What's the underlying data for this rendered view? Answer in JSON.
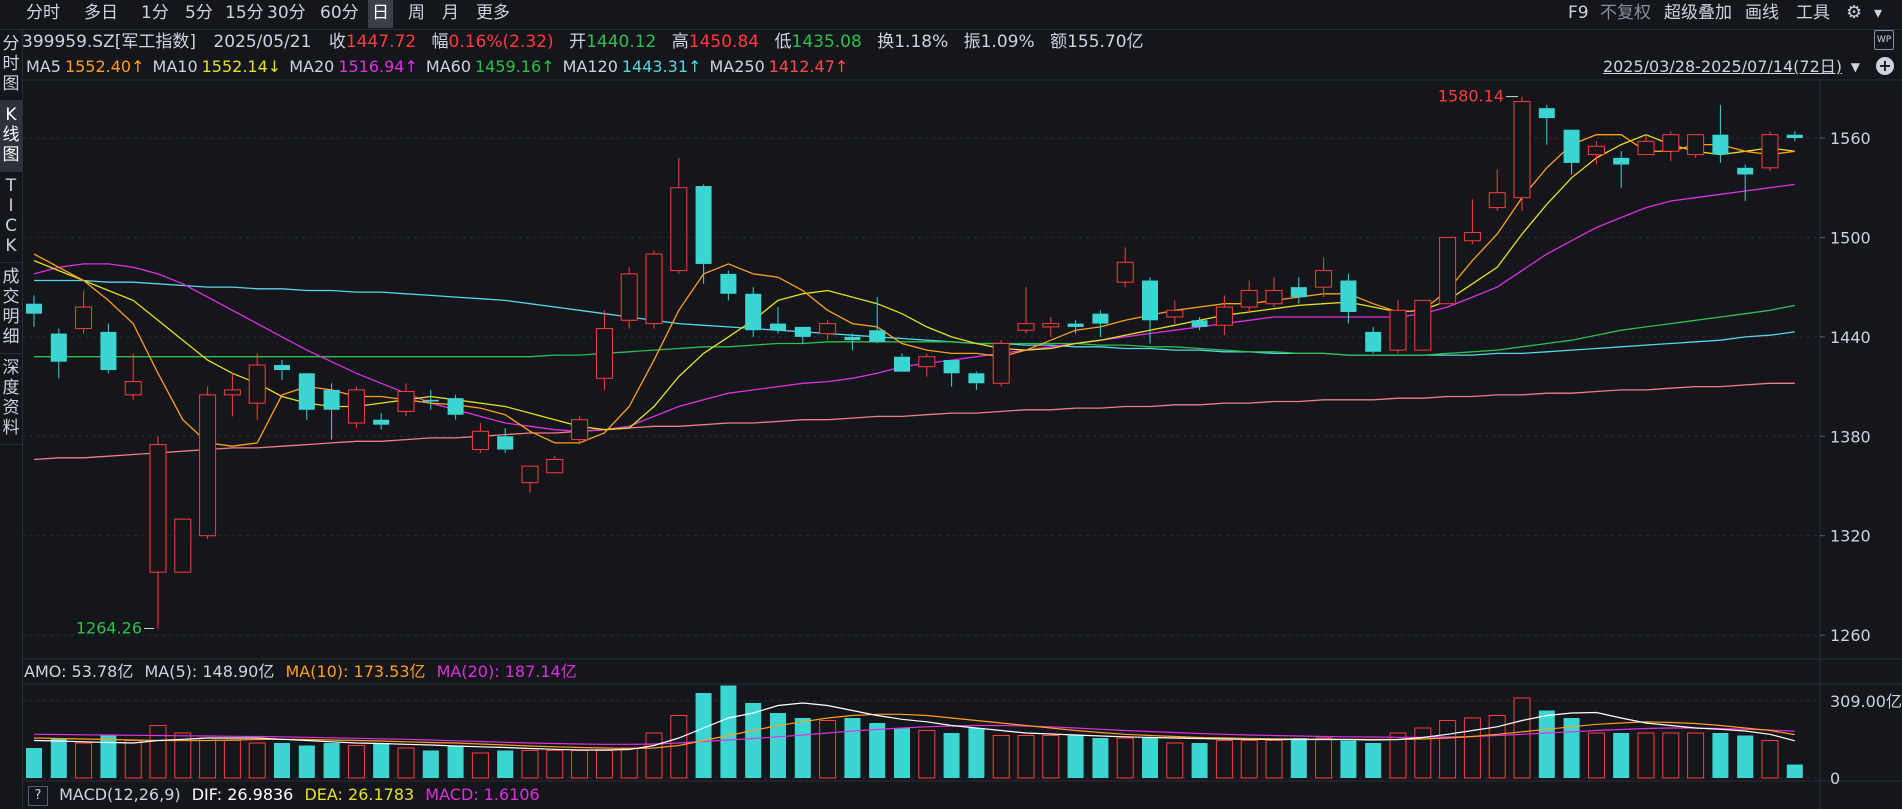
{
  "colors": {
    "up": "#ff3b3b",
    "down": "#3cd6d2",
    "ma5": "#ff9f1c",
    "ma10": "#e5e025",
    "ma20": "#e030e0",
    "ma60": "#2ec04a",
    "ma120": "#56d6e8",
    "ma250": "#f08080",
    "vol_ma5": "#ffffff",
    "vol_ma10": "#ff9f1c",
    "vol_ma20": "#e030e0"
  },
  "tabs": [
    {
      "label": "分时"
    },
    {
      "label": "多日"
    },
    {
      "label": "1分"
    },
    {
      "label": "5分"
    },
    {
      "label": "15分"
    },
    {
      "label": "30分"
    },
    {
      "label": "60分"
    },
    {
      "label": "日"
    },
    {
      "label": "周"
    },
    {
      "label": "月"
    },
    {
      "label": "更多"
    }
  ],
  "active_tab": "日",
  "right_tools": {
    "f9": "F9",
    "adjust": "不复权",
    "overlay": "超级叠加",
    "draw": "画线",
    "tools": "工具"
  },
  "sidebar": [
    {
      "label": "分时图",
      "id": "fenshi"
    },
    {
      "label": "K线图",
      "id": "kline"
    },
    {
      "label": "TICK",
      "id": "tick"
    },
    {
      "label": "成交明细",
      "id": "trade"
    },
    {
      "label": "深度资料",
      "id": "f10"
    }
  ],
  "info": {
    "code": "399959.SZ",
    "name": "[军工指数]",
    "date": "2025/05/21",
    "close_label": "收",
    "close": "1447.72",
    "change_label": "幅",
    "change": "0.16%(2.32)",
    "open_label": "开",
    "open": "1440.12",
    "high_label": "高",
    "high": "1450.84",
    "low_label": "低",
    "low": "1435.08",
    "turnover_label": "换",
    "turnover": "1.18%",
    "amplitude_label": "振",
    "amplitude": "1.09%",
    "amount_label": "额",
    "amount": "155.70亿"
  },
  "ma_legend": [
    {
      "label": "MA5",
      "value": "1552.40↑",
      "color": "#ff9f1c"
    },
    {
      "label": "MA10",
      "value": "1552.14↓",
      "color": "#e5e025"
    },
    {
      "label": "MA20",
      "value": "1516.94↑",
      "color": "#e030e0"
    },
    {
      "label": "MA60",
      "value": "1459.16↑",
      "color": "#2ec04a"
    },
    {
      "label": "MA120",
      "value": "1443.31↑",
      "color": "#56d6e8"
    },
    {
      "label": "MA250",
      "value": "1412.47↑",
      "color": "#ff4b4b"
    }
  ],
  "date_range": "2025/03/28-2025/07/14(72日)",
  "amo": {
    "label": "AMO:",
    "value": "53.78亿",
    "ma5_label": "MA(5):",
    "ma5": "148.90亿",
    "ma10_label": "MA(10):",
    "ma10": "173.53亿",
    "ma20_label": "MA(20):",
    "ma20": "187.14亿"
  },
  "macd": {
    "help": "?",
    "label": "MACD(12,26,9)",
    "dif_label": "DIF:",
    "dif": "26.9836",
    "dea_label": "DEA:",
    "dea": "26.1783",
    "macd_label": "MACD:",
    "macd": "1.6106"
  },
  "chart_data": {
    "type": "candlestick",
    "ylim": [
      1245,
      1595
    ],
    "yticks": [
      "1560",
      "1500",
      "1440",
      "1380",
      "1320",
      "1260"
    ],
    "max_label": "1580.14",
    "min_label": "1264.26",
    "candles": [
      [
        1460,
        1454,
        1465,
        1446
      ],
      [
        1442,
        1425,
        1445,
        1415
      ],
      [
        1445,
        1458,
        1468,
        1442
      ],
      [
        1443,
        1420,
        1448,
        1418
      ],
      [
        1405,
        1413,
        1430,
        1402
      ],
      [
        1298,
        1375,
        1380,
        1264
      ],
      [
        1298,
        1330,
        1330,
        1298
      ],
      [
        1320,
        1405,
        1410,
        1318
      ],
      [
        1405,
        1408,
        1418,
        1392
      ],
      [
        1400,
        1423,
        1430,
        1390
      ],
      [
        1423,
        1420,
        1426,
        1414
      ],
      [
        1418,
        1396,
        1418,
        1390
      ],
      [
        1408,
        1396,
        1412,
        1378
      ],
      [
        1388,
        1408,
        1410,
        1385
      ],
      [
        1390,
        1387,
        1394,
        1384
      ],
      [
        1395,
        1407,
        1412,
        1392
      ],
      [
        1402,
        1401,
        1408,
        1396
      ],
      [
        1403,
        1393,
        1405,
        1390
      ],
      [
        1372,
        1383,
        1388,
        1370
      ],
      [
        1380,
        1372,
        1385,
        1370
      ],
      [
        1352,
        1362,
        1362,
        1346
      ],
      [
        1358,
        1366,
        1368,
        1358
      ],
      [
        1378,
        1390,
        1392,
        1375
      ],
      [
        1415,
        1445,
        1456,
        1408
      ],
      [
        1450,
        1478,
        1482,
        1445
      ],
      [
        1448,
        1490,
        1492,
        1445
      ],
      [
        1480,
        1530,
        1548,
        1478
      ],
      [
        1531,
        1484,
        1532,
        1472
      ],
      [
        1478,
        1466,
        1480,
        1462
      ],
      [
        1466,
        1444,
        1470,
        1440
      ],
      [
        1448,
        1444,
        1458,
        1442
      ],
      [
        1446,
        1440,
        1446,
        1436
      ],
      [
        1442,
        1448,
        1450,
        1438
      ],
      [
        1440,
        1438,
        1442,
        1432
      ],
      [
        1444,
        1437,
        1464,
        1436
      ],
      [
        1428,
        1419,
        1430,
        1419
      ],
      [
        1422,
        1428,
        1430,
        1416
      ],
      [
        1426,
        1418,
        1426,
        1410
      ],
      [
        1418,
        1412,
        1419,
        1408
      ],
      [
        1412,
        1436,
        1438,
        1410
      ],
      [
        1444,
        1448,
        1470,
        1442
      ],
      [
        1446,
        1448,
        1452,
        1440
      ],
      [
        1448,
        1446,
        1450,
        1442
      ],
      [
        1454,
        1448,
        1456,
        1440
      ],
      [
        1473,
        1485,
        1494,
        1470
      ],
      [
        1474,
        1450,
        1476,
        1436
      ],
      [
        1452,
        1456,
        1462,
        1448
      ],
      [
        1450,
        1446,
        1452,
        1444
      ],
      [
        1447,
        1458,
        1465,
        1441
      ],
      [
        1458,
        1468,
        1474,
        1455
      ],
      [
        1460,
        1468,
        1476,
        1458
      ],
      [
        1470,
        1464,
        1476,
        1460
      ],
      [
        1470,
        1480,
        1488,
        1464
      ],
      [
        1474,
        1455,
        1478,
        1448
      ],
      [
        1443,
        1431,
        1446,
        1430
      ],
      [
        1432,
        1456,
        1462,
        1430
      ],
      [
        1432,
        1462,
        1462,
        1432
      ],
      [
        1460,
        1500,
        1500,
        1460
      ],
      [
        1498,
        1503,
        1523,
        1496
      ],
      [
        1518,
        1527,
        1541,
        1516
      ],
      [
        1524,
        1582,
        1585,
        1516
      ],
      [
        1578,
        1572,
        1580,
        1556
      ],
      [
        1565,
        1545,
        1565,
        1538
      ],
      [
        1550,
        1555,
        1558,
        1544
      ],
      [
        1548,
        1544,
        1552,
        1530
      ],
      [
        1550,
        1558,
        1562,
        1550
      ],
      [
        1552,
        1562,
        1564,
        1546
      ],
      [
        1550,
        1562,
        1562,
        1548
      ],
      [
        1562,
        1550,
        1580,
        1545
      ],
      [
        1542,
        1538,
        1544,
        1522
      ],
      [
        1542,
        1562,
        1564,
        1540
      ],
      [
        1562,
        1560,
        1564,
        1558
      ]
    ],
    "ma5": [
      1490,
      1482,
      1474,
      1462,
      1448,
      1418,
      1390,
      1376,
      1374,
      1376,
      1405,
      1410,
      1408,
      1404,
      1404,
      1402,
      1400,
      1399,
      1397,
      1393,
      1383,
      1376,
      1376,
      1382,
      1398,
      1426,
      1456,
      1478,
      1484,
      1478,
      1476,
      1468,
      1456,
      1448,
      1446,
      1436,
      1432,
      1430,
      1430,
      1428,
      1432,
      1438,
      1444,
      1446,
      1450,
      1453,
      1456,
      1458,
      1460,
      1460,
      1462,
      1464,
      1466,
      1466,
      1460,
      1455,
      1456,
      1468,
      1486,
      1502,
      1524,
      1542,
      1556,
      1562,
      1562,
      1552,
      1552,
      1556,
      1556,
      1552,
      1550,
      1552
    ],
    "ma10": [
      1486,
      1480,
      1474,
      1468,
      1462,
      1450,
      1438,
      1426,
      1418,
      1412,
      1404,
      1400,
      1398,
      1398,
      1400,
      1402,
      1404,
      1402,
      1400,
      1398,
      1394,
      1390,
      1386,
      1384,
      1385,
      1398,
      1416,
      1430,
      1440,
      1450,
      1462,
      1466,
      1468,
      1464,
      1460,
      1454,
      1446,
      1440,
      1436,
      1433,
      1432,
      1433,
      1436,
      1438,
      1441,
      1444,
      1447,
      1450,
      1453,
      1455,
      1457,
      1459,
      1460,
      1461,
      1458,
      1455,
      1456,
      1462,
      1472,
      1482,
      1502,
      1520,
      1536,
      1548,
      1556,
      1562,
      1556,
      1552,
      1550,
      1552,
      1554,
      1552
    ],
    "ma20": [
      1478,
      1482,
      1484,
      1484,
      1482,
      1478,
      1472,
      1464,
      1456,
      1448,
      1440,
      1432,
      1425,
      1418,
      1412,
      1406,
      1400,
      1396,
      1392,
      1388,
      1386,
      1384,
      1383,
      1384,
      1386,
      1392,
      1398,
      1402,
      1406,
      1408,
      1410,
      1412,
      1413,
      1415,
      1418,
      1422,
      1424,
      1426,
      1428,
      1430,
      1432,
      1434,
      1436,
      1438,
      1440,
      1442,
      1444,
      1446,
      1448,
      1450,
      1452,
      1452,
      1452,
      1452,
      1452,
      1452,
      1454,
      1458,
      1464,
      1470,
      1480,
      1490,
      1498,
      1506,
      1512,
      1518,
      1522,
      1524,
      1526,
      1528,
      1530,
      1532
    ],
    "ma60": [
      1428,
      1428,
      1428,
      1428,
      1428,
      1428,
      1428,
      1428,
      1428,
      1428,
      1428,
      1428,
      1428,
      1428,
      1428,
      1428,
      1428,
      1428,
      1428,
      1428,
      1428,
      1429,
      1429,
      1430,
      1431,
      1432,
      1433,
      1434,
      1434,
      1435,
      1436,
      1436,
      1437,
      1437,
      1437,
      1437,
      1437,
      1437,
      1436,
      1436,
      1436,
      1436,
      1436,
      1435,
      1435,
      1434,
      1434,
      1433,
      1432,
      1431,
      1431,
      1430,
      1430,
      1429,
      1429,
      1429,
      1429,
      1430,
      1431,
      1432,
      1434,
      1436,
      1438,
      1441,
      1444,
      1446,
      1448,
      1450,
      1452,
      1454,
      1456,
      1459
    ],
    "ma120": [
      1474,
      1474,
      1474,
      1473,
      1473,
      1472,
      1471,
      1470,
      1470,
      1469,
      1469,
      1468,
      1468,
      1467,
      1467,
      1466,
      1465,
      1464,
      1463,
      1462,
      1460,
      1458,
      1456,
      1454,
      1452,
      1450,
      1448,
      1447,
      1446,
      1445,
      1444,
      1443,
      1442,
      1441,
      1440,
      1439,
      1438,
      1437,
      1436,
      1436,
      1435,
      1435,
      1434,
      1434,
      1433,
      1433,
      1432,
      1432,
      1431,
      1431,
      1430,
      1430,
      1430,
      1429,
      1429,
      1429,
      1429,
      1429,
      1429,
      1430,
      1430,
      1431,
      1432,
      1433,
      1434,
      1435,
      1436,
      1437,
      1438,
      1440,
      1441,
      1443
    ],
    "ma250": [
      1366,
      1367,
      1367,
      1368,
      1369,
      1370,
      1371,
      1372,
      1373,
      1373,
      1374,
      1375,
      1376,
      1377,
      1377,
      1378,
      1379,
      1379,
      1380,
      1381,
      1382,
      1382,
      1383,
      1384,
      1385,
      1386,
      1386,
      1387,
      1388,
      1388,
      1389,
      1390,
      1390,
      1391,
      1392,
      1392,
      1393,
      1394,
      1394,
      1395,
      1396,
      1396,
      1397,
      1397,
      1398,
      1398,
      1399,
      1399,
      1400,
      1400,
      1401,
      1401,
      1402,
      1402,
      1402,
      1403,
      1403,
      1404,
      1404,
      1405,
      1405,
      1406,
      1406,
      1407,
      1408,
      1408,
      1409,
      1410,
      1410,
      1411,
      1412,
      1412
    ],
    "volume": {
      "ylim": [
        0,
        360
      ],
      "yticks": [
        "309.00亿",
        "0"
      ],
      "values": [
        120,
        160,
        140,
        170,
        150,
        210,
        180,
        160,
        150,
        140,
        140,
        130,
        140,
        130,
        140,
        120,
        110,
        130,
        100,
        110,
        110,
        110,
        110,
        110,
        120,
        180,
        250,
        340,
        370,
        300,
        260,
        240,
        230,
        240,
        220,
        200,
        190,
        180,
        200,
        170,
        170,
        170,
        170,
        160,
        160,
        160,
        140,
        140,
        150,
        150,
        150,
        160,
        160,
        150,
        140,
        180,
        200,
        230,
        240,
        250,
        320,
        270,
        240,
        180,
        180,
        180,
        180,
        180,
        180,
        170,
        150,
        53.78
      ],
      "ma5": [
        150,
        148,
        145,
        142,
        140,
        150,
        155,
        160,
        160,
        160,
        155,
        150,
        145,
        140,
        138,
        135,
        132,
        128,
        125,
        122,
        118,
        115,
        112,
        112,
        114,
        130,
        160,
        200,
        240,
        260,
        290,
        300,
        290,
        270,
        250,
        235,
        225,
        210,
        200,
        190,
        180,
        176,
        172,
        168,
        165,
        162,
        160,
        158,
        156,
        155,
        154,
        154,
        154,
        154,
        152,
        154,
        162,
        175,
        190,
        205,
        230,
        250,
        260,
        262,
        240,
        220,
        210,
        200,
        195,
        188,
        175,
        148.9
      ],
      "ma10": [
        160,
        158,
        156,
        154,
        152,
        150,
        150,
        150,
        152,
        154,
        155,
        154,
        152,
        150,
        148,
        145,
        142,
        140,
        136,
        132,
        128,
        125,
        122,
        120,
        118,
        120,
        130,
        150,
        170,
        190,
        210,
        225,
        240,
        250,
        255,
        255,
        250,
        240,
        230,
        220,
        210,
        200,
        190,
        182,
        175,
        170,
        166,
        162,
        160,
        158,
        157,
        156,
        155,
        155,
        154,
        154,
        156,
        160,
        166,
        175,
        185,
        195,
        205,
        215,
        220,
        225,
        222,
        218,
        210,
        200,
        190,
        173.53
      ],
      "ma20": [
        175,
        174,
        173,
        172,
        171,
        170,
        169,
        168,
        167,
        166,
        165,
        163,
        161,
        159,
        157,
        155,
        152,
        149,
        146,
        143,
        140,
        138,
        136,
        135,
        135,
        136,
        140,
        146,
        152,
        158,
        165,
        172,
        180,
        188,
        194,
        200,
        205,
        208,
        210,
        210,
        208,
        205,
        200,
        195,
        190,
        186,
        182,
        178,
        175,
        172,
        170,
        168,
        166,
        165,
        164,
        163,
        163,
        164,
        166,
        170,
        175,
        180,
        185,
        190,
        194,
        198,
        200,
        200,
        198,
        195,
        192,
        187.14
      ]
    }
  }
}
